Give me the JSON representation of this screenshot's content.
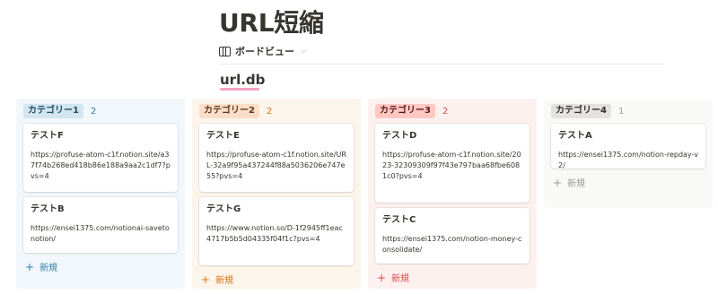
{
  "page": {
    "title": "URL短縮"
  },
  "view": {
    "label": "ボードビュー",
    "chevron": "⌵"
  },
  "database": {
    "title": "url.db"
  },
  "colors": {
    "cat1_bg": "#f1f7fb",
    "cat1_tag": "#d3e5ef",
    "cat1_text": "#1f4d63",
    "cat1_accent": "#337ea9",
    "cat2_bg": "#fbf5ec",
    "cat2_tag": "#fadec9",
    "cat2_text": "#5e3a1c",
    "cat2_accent": "#d9730d",
    "cat3_bg": "#fdf1f0",
    "cat3_tag": "#ffc9c2",
    "cat3_text": "#5d1715",
    "cat3_accent": "#d44c47",
    "cat4_bg": "#f9f9f8",
    "cat4_tag": "#e3e2e0",
    "cat4_text": "#32302c",
    "cat4_accent": "#9b9a97"
  },
  "columns": [
    {
      "name": "カテゴリー1",
      "count": "2",
      "new_label": "新規",
      "cards": [
        {
          "title": "テストF",
          "url": "https://profuse-atom-c1f.notion.site/a37f74b268ed418b86e188a9aa2c1df7?pvs=4"
        },
        {
          "title": "テストB",
          "url": "https://ensei1375.com/notionai-savetonotion/"
        }
      ]
    },
    {
      "name": "カテゴリー2",
      "count": "2",
      "new_label": "新規",
      "cards": [
        {
          "title": "テストE",
          "url": "https://profuse-atom-c1f.notion.site/URL-32a9f95a437244f88a5036206e747e55?pvs=4"
        },
        {
          "title": "テストG",
          "url": "https://www.notion.so/D-1f2945ff1eac4717b5b5d04335f04f1c?pvs=4"
        }
      ]
    },
    {
      "name": "カテゴリー3",
      "count": "2",
      "new_label": "新規",
      "cards": [
        {
          "title": "テストD",
          "url": "https://profuse-atom-c1f.notion.site/2023-32309309f97f43e797baa68fbe6081c0?pvs=4"
        },
        {
          "title": "テストC",
          "url": "https://ensei1375.com/notion-money-consolidate/"
        }
      ]
    },
    {
      "name": "カテゴリー4",
      "count": "1",
      "new_label": "新規",
      "cards": [
        {
          "title": "テストA",
          "url": "https://ensei1375.com/notion-repday-v2/"
        }
      ]
    }
  ]
}
